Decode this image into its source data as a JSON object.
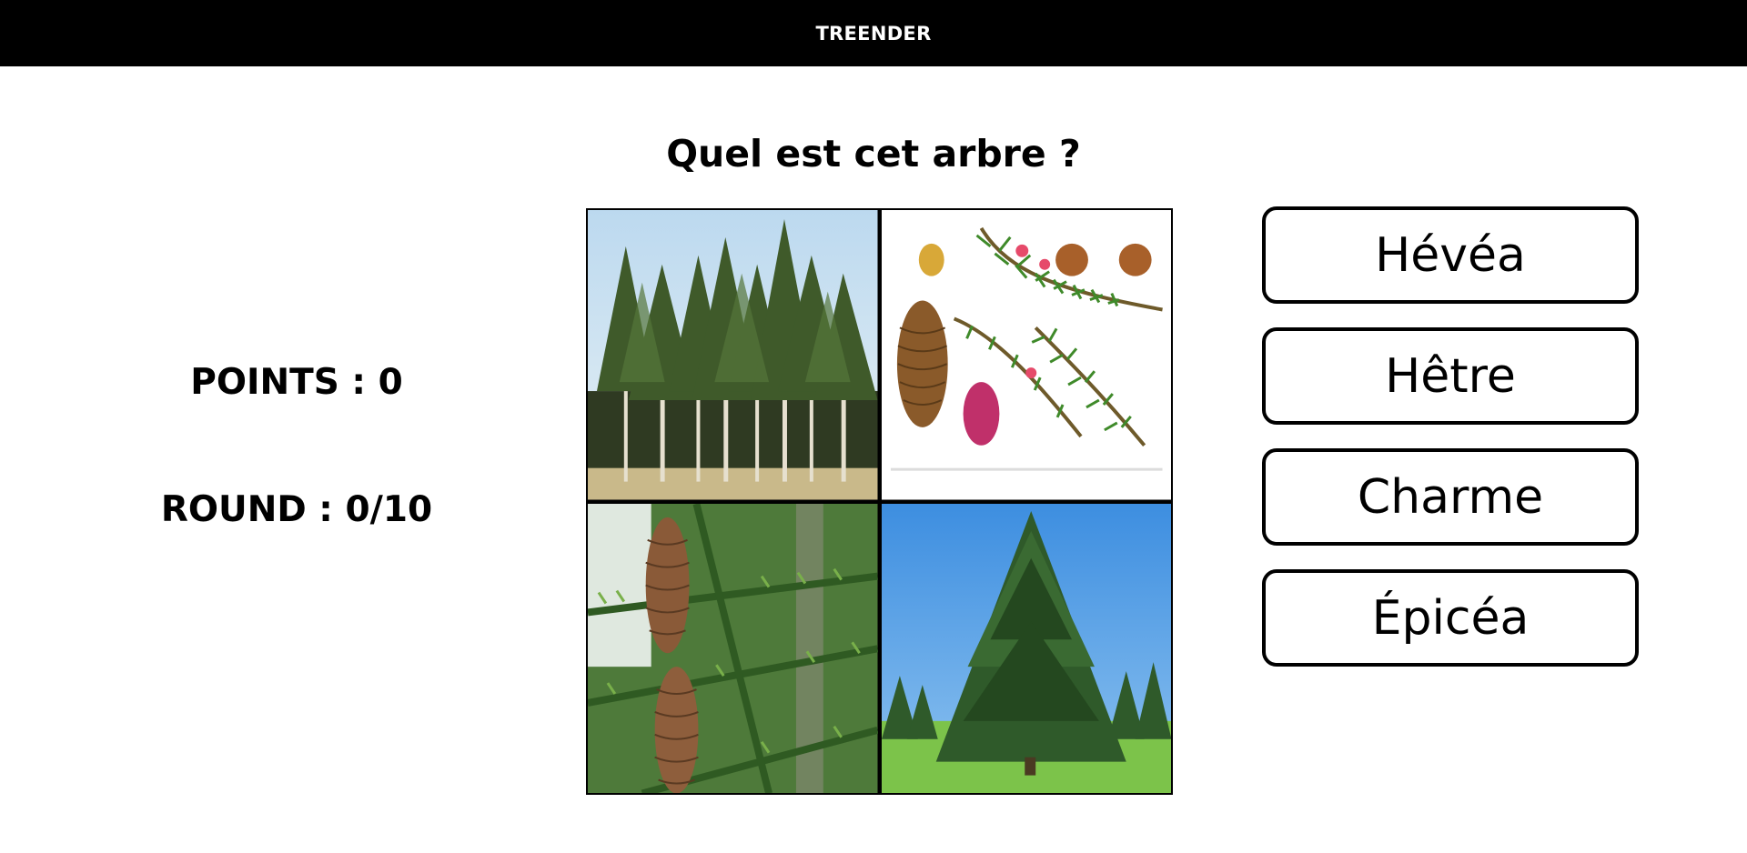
{
  "header": {
    "brand": "TREENDER"
  },
  "question": "Quel est cet arbre ?",
  "stats": {
    "points": "POINTS : 0",
    "round": "ROUND : 0/10"
  },
  "images": [
    {
      "icon": "forest-photo"
    },
    {
      "icon": "botanical-illustration"
    },
    {
      "icon": "pine-cone-photo"
    },
    {
      "icon": "spruce-tree-photo"
    }
  ],
  "answers": [
    {
      "label": "Hévéa"
    },
    {
      "label": "Hêtre"
    },
    {
      "label": "Charme"
    },
    {
      "label": "Épicéa"
    }
  ],
  "colors": {
    "header_bg": "#000000",
    "header_text": "#ffffff",
    "border": "#000000"
  }
}
